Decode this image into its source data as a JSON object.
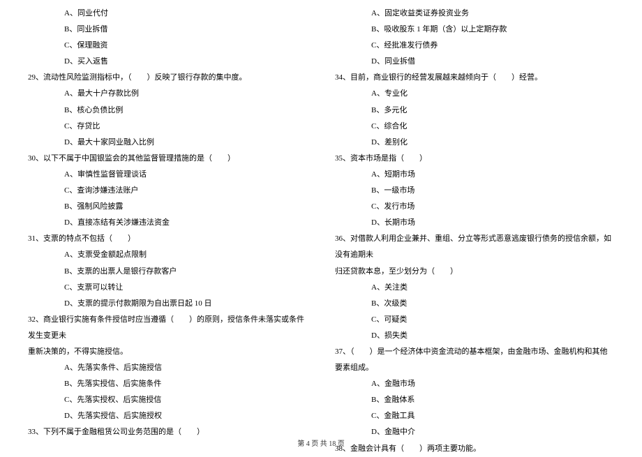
{
  "leftColumn": {
    "pre_options": [
      "A、同业代付",
      "B、同业拆借",
      "C、保理融资",
      "D、买入返售"
    ],
    "q29": {
      "text": "29、流动性风险监测指标中，（　　）反映了银行存款的集中度。",
      "options": [
        "A、最大十户存款比例",
        "B、核心负债比例",
        "C、存贷比",
        "D、最大十家同业融入比例"
      ]
    },
    "q30": {
      "text": "30、以下不属于中国银监会的其他监督管理措施的是（　　）",
      "options": [
        "A、审慎性监督管理谈话",
        "C、查询涉嫌违法账户",
        "B、强制风险披露",
        "D、直接冻结有关涉嫌违法资金"
      ]
    },
    "q31": {
      "text": "31、支票的特点不包括（　　）",
      "options": [
        "A、支票受金额起点限制",
        "B、支票的出票人是银行存款客户",
        "C、支票可以转让",
        "D、支票的提示付款期限为自出票日起 10 日"
      ]
    },
    "q32": {
      "text": "32、商业银行实施有条件授信时应当遵循（　　）的原则，授信条件未落实或条件发生变更未",
      "cont": "重新决策的，不得实施授信。",
      "options": [
        "A、先落实条件、后实施授信",
        "B、先落实授信、后实施条件",
        "C、先落实授权、后实施授信",
        "D、先落实授信、后实施授权"
      ]
    },
    "q33": {
      "text": "33、下列不属于金融租赁公司业务范围的是（　　）"
    }
  },
  "rightColumn": {
    "pre_options": [
      "A、固定收益类证券投资业务",
      "B、吸收股东 1 年期（含）以上定期存款",
      "C、经批准发行债券",
      "D、同业拆借"
    ],
    "q34": {
      "text": "34、目前，商业银行的经营发展越来越倾向于（　　）经营。",
      "options": [
        "A、专业化",
        "B、多元化",
        "C、综合化",
        "D、差别化"
      ]
    },
    "q35": {
      "text": "35、资本市场是指（　　）",
      "options": [
        "A、短期市场",
        "B、一级市场",
        "C、发行市场",
        "D、长期市场"
      ]
    },
    "q36": {
      "text": "36、对借款人利用企业兼并、重组、分立等形式恶意逃废银行债务的授信余额，如没有逾期未",
      "cont": "归还贷款本息，至少划分为（　　）",
      "options": [
        "A、关注类",
        "B、次级类",
        "C、可疑类",
        "D、损失类"
      ]
    },
    "q37": {
      "text": "37、（　　）是一个经济体中资金流动的基本框架，由金融市场、金融机构和其他要素组成。",
      "options": [
        "A、金融市场",
        "B、金融体系",
        "C、金融工具",
        "D、金融中介"
      ]
    },
    "q38": {
      "text": "38、金融会计具有（　　）两项主要功能。"
    }
  },
  "footer": "第 4 页 共 18 页"
}
